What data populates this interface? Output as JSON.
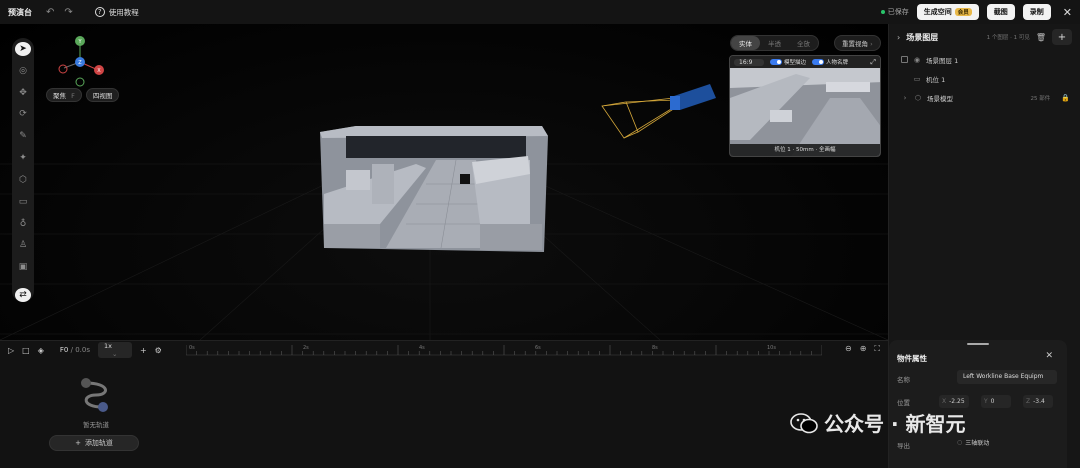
{
  "app": {
    "title": "预演台",
    "tutorial": "使用教程"
  },
  "topbar": {
    "saved": "已保存",
    "generate_space": "生成空间",
    "vip_badge": "会员",
    "screenshot": "截图",
    "record": "录制"
  },
  "viewport": {
    "gizmo": {
      "y": "Y",
      "z": "Z",
      "x": "X"
    },
    "focus_btn": "聚焦",
    "focus_key": "F",
    "quad_view_btn": "四视图",
    "render_modes": [
      "实体",
      "半透",
      "全放"
    ],
    "reset_view": "重置视角",
    "tool_icons": [
      "select-icon",
      "eye-icon",
      "move-icon",
      "rotate-icon",
      "pen-icon",
      "light-icon",
      "cube-icon",
      "camera-icon",
      "bulb-icon",
      "person-icon",
      "image-icon",
      "route-icon"
    ]
  },
  "preview": {
    "ratio": "16:9",
    "toggle_model": "模型描边",
    "toggle_character": "人物名牌",
    "caption": "机位 1 · 50mm · 全画幅"
  },
  "scene_panel": {
    "title": "场景图层",
    "meta": "1 个图层 · 1 可见",
    "layer": "场景图层 1",
    "camera": "机位 1",
    "model": "场景模型",
    "model_count": "25 部件"
  },
  "properties": {
    "title": "物件属性",
    "name_label": "名称",
    "name_value": "Left Workline Base Equipm",
    "position_label": "位置",
    "x": "-2.25",
    "y": "0",
    "z": "-3.4",
    "export_label": "导出",
    "link_option": "三轴联动"
  },
  "timeline": {
    "frame": "F0",
    "time": "0.0s",
    "speed": "1x",
    "ticks": [
      "0s",
      "2s",
      "4s",
      "6s",
      "8s",
      "10s"
    ],
    "empty_label": "暂无轨道",
    "add_track": "添加轨道"
  },
  "watermark": {
    "text": "公众号 · 新智元"
  }
}
